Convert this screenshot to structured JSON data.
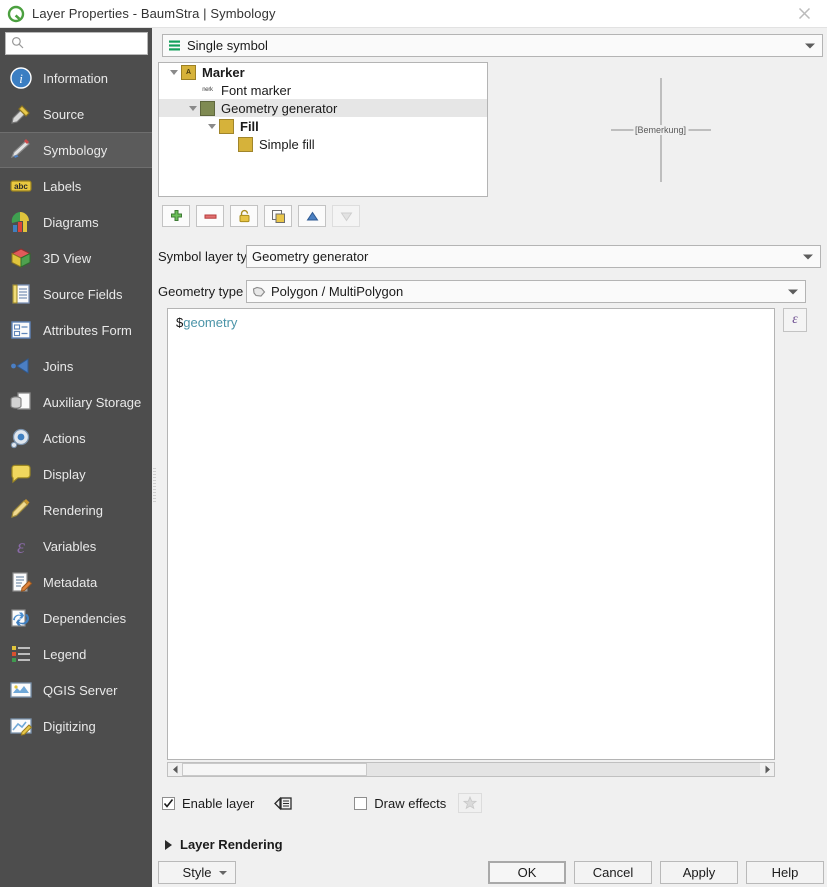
{
  "window": {
    "title": "Layer Properties - BaumStra | Symbology",
    "app_icon": "qgis-logo-icon",
    "close_label": "✕"
  },
  "sidebar": {
    "search": {
      "value": "",
      "placeholder": ""
    },
    "items": [
      {
        "label": "Information",
        "icon": "information-icon",
        "active": false
      },
      {
        "label": "Source",
        "icon": "source-icon",
        "active": false
      },
      {
        "label": "Symbology",
        "icon": "symbology-brush-icon",
        "active": true
      },
      {
        "label": "Labels",
        "icon": "labels-abc-icon",
        "active": false
      },
      {
        "label": "Diagrams",
        "icon": "diagrams-icon",
        "active": false
      },
      {
        "label": "3D View",
        "icon": "3d-view-cube-icon",
        "active": false
      },
      {
        "label": "Source Fields",
        "icon": "source-fields-icon",
        "active": false
      },
      {
        "label": "Attributes Form",
        "icon": "attributes-form-icon",
        "active": false
      },
      {
        "label": "Joins",
        "icon": "joins-icon",
        "active": false
      },
      {
        "label": "Auxiliary Storage",
        "icon": "auxiliary-storage-icon",
        "active": false
      },
      {
        "label": "Actions",
        "icon": "actions-gear-icon",
        "active": false
      },
      {
        "label": "Display",
        "icon": "display-balloon-icon",
        "active": false
      },
      {
        "label": "Rendering",
        "icon": "rendering-brush-icon",
        "active": false
      },
      {
        "label": "Variables",
        "icon": "variables-icon",
        "active": false
      },
      {
        "label": "Metadata",
        "icon": "metadata-icon",
        "active": false
      },
      {
        "label": "Dependencies",
        "icon": "dependencies-icon",
        "active": false
      },
      {
        "label": "Legend",
        "icon": "legend-icon",
        "active": false
      },
      {
        "label": "QGIS Server",
        "icon": "qgis-server-icon",
        "active": false
      },
      {
        "label": "Digitizing",
        "icon": "digitizing-icon",
        "active": false
      }
    ]
  },
  "symbology": {
    "renderer": {
      "label": "Single symbol",
      "icon": "single-symbol-icon"
    },
    "tree": [
      {
        "label": "Marker",
        "indent": 0,
        "bold": true,
        "selected": false,
        "twisty": true,
        "icon": "marker-a-icon",
        "color": "#d6b23a"
      },
      {
        "label": "Font marker",
        "indent": 1,
        "bold": false,
        "selected": false,
        "twisty": false,
        "icon": "font-marker-icon",
        "color": ""
      },
      {
        "label": "Geometry generator",
        "indent": 1,
        "bold": false,
        "selected": true,
        "twisty": true,
        "icon": "swatch-icon",
        "color": "#7f8a52"
      },
      {
        "label": "Fill",
        "indent": 2,
        "bold": true,
        "selected": false,
        "twisty": true,
        "icon": "swatch-icon",
        "color": "#d6b23a"
      },
      {
        "label": "Simple fill",
        "indent": 3,
        "bold": false,
        "selected": false,
        "twisty": false,
        "icon": "swatch-icon",
        "color": "#d6b23a"
      }
    ],
    "tree_toolbar": [
      {
        "name": "add-symbol-layer-button",
        "icon": "plus-icon",
        "enabled": true
      },
      {
        "name": "remove-symbol-layer-button",
        "icon": "minus-icon",
        "enabled": true
      },
      {
        "name": "lock-layer-colors-button",
        "icon": "lock-icon",
        "enabled": true
      },
      {
        "name": "duplicate-symbol-layer-button",
        "icon": "duplicate-icon",
        "enabled": true
      },
      {
        "name": "move-layer-up-button",
        "icon": "arrow-up-icon",
        "enabled": true
      },
      {
        "name": "move-layer-down-button",
        "icon": "arrow-down-icon",
        "enabled": false
      }
    ],
    "preview": {
      "label": "[Bemerkung]"
    },
    "symbol_layer_type": {
      "label": "Symbol layer type",
      "value": "Geometry generator"
    },
    "geometry_type": {
      "label": "Geometry type",
      "value": "Polygon / MultiPolygon",
      "icon": "polygon-icon"
    },
    "expression": {
      "prefix": "$",
      "word": "geometry",
      "full": "$geometry"
    },
    "expression_builder_button": {
      "glyph": "ε"
    }
  },
  "options": {
    "enable_layer": {
      "label": "Enable layer",
      "checked": true
    },
    "data_defined_override": {
      "icon": "data-defined-override-icon"
    },
    "draw_effects": {
      "label": "Draw effects",
      "checked": false
    },
    "effects_button": {
      "icon": "effects-star-icon",
      "enabled": false
    }
  },
  "layer_rendering": {
    "label": "Layer Rendering",
    "expanded": false
  },
  "footer": {
    "style": "Style",
    "ok": "OK",
    "cancel": "Cancel",
    "apply": "Apply",
    "help": "Help"
  },
  "colors": {
    "sidebar_bg": "#4d4d4d",
    "dialog_bg": "#f0f0f0",
    "marker_gold": "#d6b23a",
    "geometry_olive": "#7f8a52",
    "accent_green": "#13a05a",
    "expr_word": "#4b94a8",
    "epsilon_purple": "#6b4b8f"
  }
}
